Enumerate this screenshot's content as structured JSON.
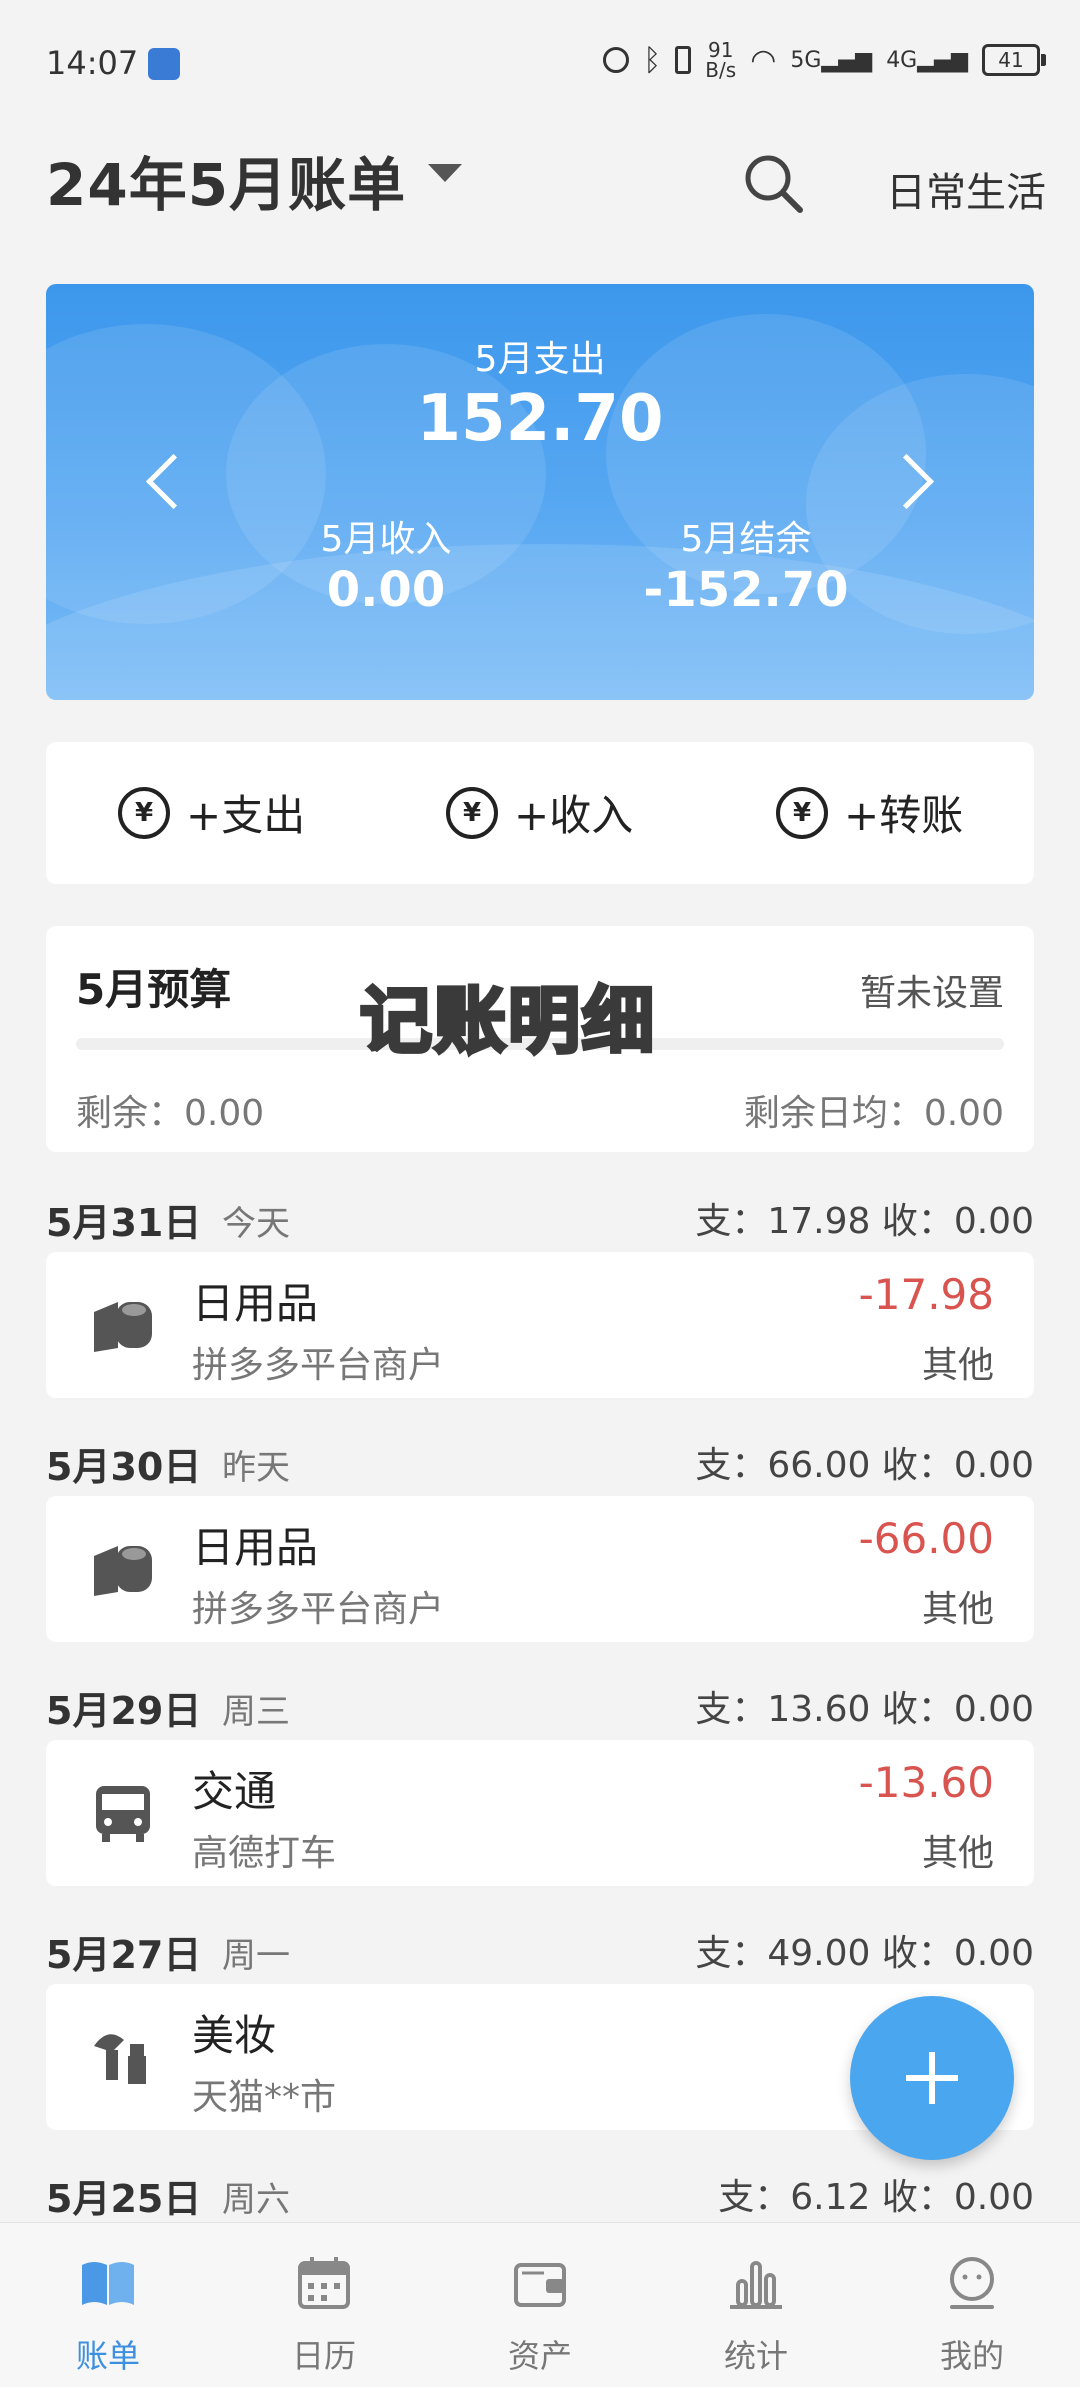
{
  "status_bar": {
    "time": "14:07",
    "net_speed_value": "91",
    "net_speed_unit": "B/s",
    "battery": "41"
  },
  "header": {
    "title": "24年5月账单",
    "book_name": "日常生活"
  },
  "summary": {
    "expense_label": "5月支出",
    "expense_value": "152.70",
    "income_label": "5月收入",
    "income_value": "0.00",
    "balance_label": "5月结余",
    "balance_value": "-152.70"
  },
  "actions": {
    "expense": "+支出",
    "income": "+收入",
    "transfer": "+转账"
  },
  "budget": {
    "title": "5月预算",
    "status": "暂未设置",
    "remaining": "剩余：0.00",
    "daily_remaining": "剩余日均：0.00",
    "progress": 0
  },
  "overlay_caption": "记账明细",
  "days": [
    {
      "date": "5月31日",
      "relative": "今天",
      "summary": "支：17.98   收：0.00",
      "tx": {
        "category": "日用品",
        "merchant": "拼多多平台商户",
        "amount": "-17.98",
        "account": "其他",
        "icon": "toilet-paper-icon"
      }
    },
    {
      "date": "5月30日",
      "relative": "昨天",
      "summary": "支：66.00   收：0.00",
      "tx": {
        "category": "日用品",
        "merchant": "拼多多平台商户",
        "amount": "-66.00",
        "account": "其他",
        "icon": "toilet-paper-icon"
      }
    },
    {
      "date": "5月29日",
      "relative": "周三",
      "summary": "支：13.60   收：0.00",
      "tx": {
        "category": "交通",
        "merchant": "高德打车",
        "amount": "-13.60",
        "account": "其他",
        "icon": "bus-icon"
      }
    },
    {
      "date": "5月27日",
      "relative": "周一",
      "summary": "支：49.00   收：0.00",
      "tx": {
        "category": "美妆",
        "merchant": "天猫**市",
        "amount": "",
        "account": "",
        "icon": "cosmetics-icon"
      }
    },
    {
      "date": "5月25日",
      "relative": "周六",
      "summary": "支：6.12   收：0.00"
    }
  ],
  "tabs": [
    {
      "label": "账单",
      "icon": "book-icon",
      "active": true
    },
    {
      "label": "日历",
      "icon": "calendar-icon",
      "active": false
    },
    {
      "label": "资产",
      "icon": "wallet-icon",
      "active": false
    },
    {
      "label": "统计",
      "icon": "chart-icon",
      "active": false
    },
    {
      "label": "我的",
      "icon": "profile-icon",
      "active": false
    }
  ],
  "colors": {
    "accent": "#3d8fe0",
    "expense_red": "#d9534f",
    "card_blue": "#3c97ec"
  }
}
